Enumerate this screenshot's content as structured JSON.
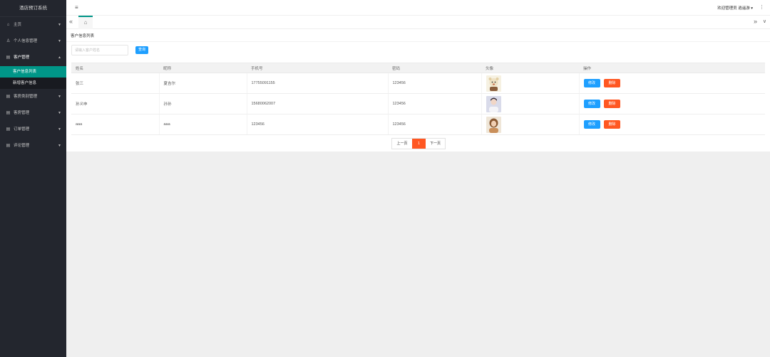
{
  "app": {
    "title": "酒店预订系统"
  },
  "sidebar": {
    "items": [
      {
        "icon": "home-icon",
        "label": "主页",
        "open": false
      },
      {
        "icon": "user-icon",
        "label": "个人信息管理",
        "open": false
      },
      {
        "icon": "grid-icon",
        "label": "客户管理",
        "open": true,
        "children": [
          {
            "label": "客户信息列表",
            "active": true
          },
          {
            "label": "新增客户信息",
            "active": false
          }
        ]
      },
      {
        "icon": "grid-icon",
        "label": "客房类别管理",
        "open": false
      },
      {
        "icon": "grid-icon",
        "label": "客房管理",
        "open": false
      },
      {
        "icon": "grid-icon",
        "label": "订单管理",
        "open": false
      },
      {
        "icon": "grid-icon",
        "label": "评论管理",
        "open": false
      }
    ]
  },
  "header": {
    "welcome": "欢迎管理员 逍遥游",
    "caret": "▾",
    "more": "⋮",
    "menu_icon": "≡"
  },
  "tabs": {
    "prev": "«",
    "home_icon": "⌂",
    "next": "»",
    "down": "∨"
  },
  "page": {
    "title": "客户信息列表",
    "search": {
      "placeholder": "请输入客户姓名",
      "button": "查询"
    },
    "table": {
      "headers": [
        "姓名",
        "昵称",
        "手机号",
        "密码",
        "头像",
        "操作"
      ],
      "rows": [
        {
          "name": "张三",
          "nickname": "夏吉尔",
          "phone": "17755091155",
          "password": "123456",
          "avatar": "avatar-cartoon-bear"
        },
        {
          "name": "孙义申",
          "nickname": "孙孙",
          "phone": "15680062007",
          "password": "123456",
          "avatar": "avatar-portrait-boy"
        },
        {
          "name": "aaa",
          "nickname": "aaa",
          "phone": "123456",
          "password": "123456",
          "avatar": "avatar-portrait-girl"
        }
      ],
      "edit_label": "修改",
      "delete_label": "删除"
    },
    "pagination": {
      "prev": "上一页",
      "current": "1",
      "next": "下一页"
    }
  },
  "colors": {
    "sidebar_bg": "#23262e",
    "active_bg": "#009688",
    "primary": "#1e9fff",
    "danger": "#ff5722"
  }
}
